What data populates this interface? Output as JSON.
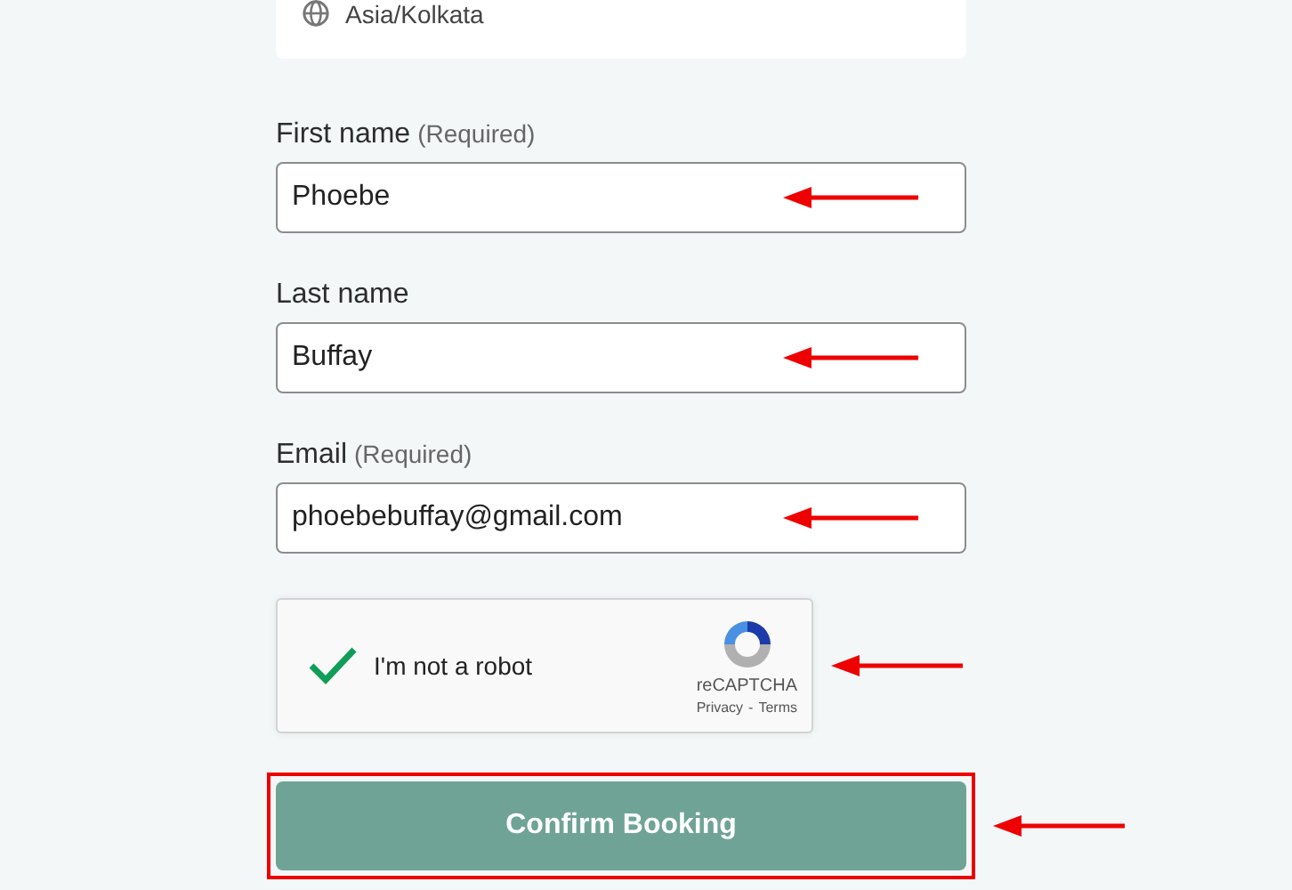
{
  "timezone": {
    "value": "Asia/Kolkata"
  },
  "fields": [
    {
      "label": "First name",
      "note": "(Required)",
      "value": "Phoebe",
      "annotated": true
    },
    {
      "label": "Last name",
      "value": "Buffay",
      "annotated": true
    },
    {
      "label": "Email",
      "note": "(Required)",
      "value": "phoebebuffay@gmail.com",
      "annotated": true
    }
  ],
  "captcha": {
    "label": "I'm not a robot",
    "checked": true,
    "brand": "reCAPTCHA",
    "links": [
      "Privacy",
      "Terms"
    ],
    "separator": "-",
    "annotated": true
  },
  "button": {
    "label": "Confirm Booking",
    "highlighted": true,
    "annotated": true
  }
}
